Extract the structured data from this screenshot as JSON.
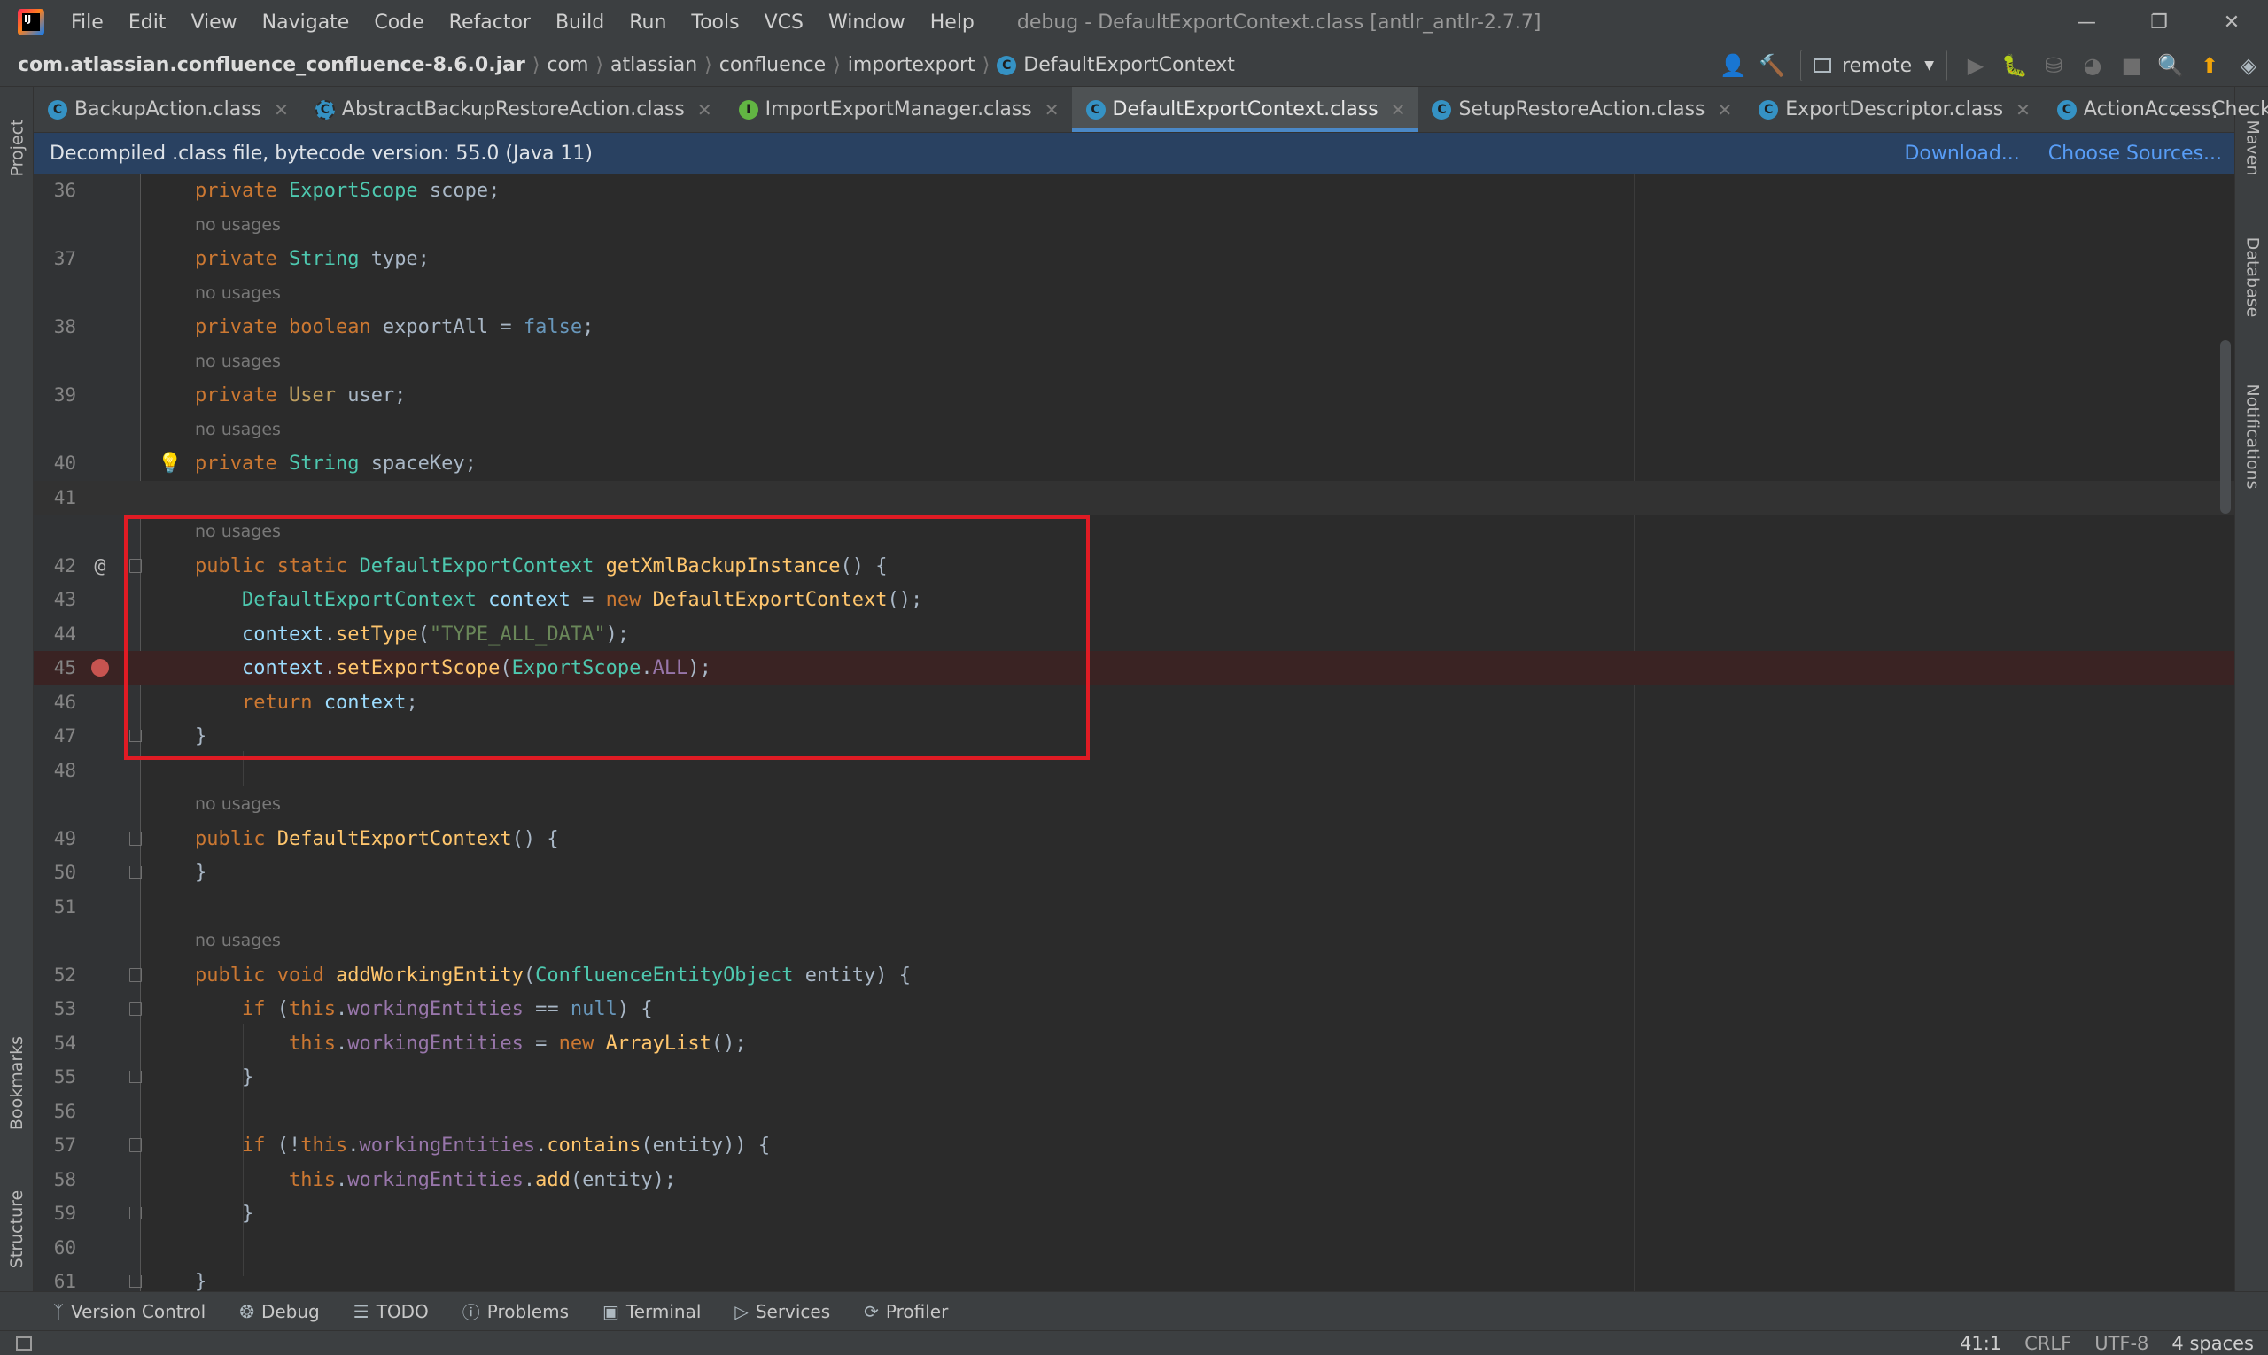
{
  "menubar": {
    "items": [
      "File",
      "Edit",
      "View",
      "Navigate",
      "Code",
      "Refactor",
      "Build",
      "Run",
      "Tools",
      "VCS",
      "Window",
      "Help"
    ],
    "window_title": "debug - DefaultExportContext.class [antlr_antlr-2.7.7]"
  },
  "breadcrumb": {
    "items": [
      "com.atlassian.confluence_confluence-8.6.0.jar",
      "com",
      "atlassian",
      "confluence",
      "importexport",
      "DefaultExportContext"
    ]
  },
  "toolbar": {
    "run_config": "remote"
  },
  "tabs": [
    {
      "label": "BackupAction.class",
      "icon": "class",
      "active": false
    },
    {
      "label": "AbstractBackupRestoreAction.class",
      "icon": "abstract-class",
      "active": false
    },
    {
      "label": "ImportExportManager.class",
      "icon": "interface",
      "active": false
    },
    {
      "label": "DefaultExportContext.class",
      "icon": "class",
      "active": true
    },
    {
      "label": "SetupRestoreAction.class",
      "icon": "class",
      "active": false
    },
    {
      "label": "ExportDescriptor.class",
      "icon": "class",
      "active": false
    },
    {
      "label": "ActionAccessChecker.c",
      "icon": "class",
      "active": false
    }
  ],
  "banner": {
    "text": "Decompiled .class file, bytecode version: 55.0 (Java 11)",
    "download": "Download...",
    "choose_sources": "Choose Sources..."
  },
  "side_tabs": {
    "project": "Project",
    "bookmarks": "Bookmarks",
    "structure": "Structure",
    "maven": "Maven",
    "database": "Database",
    "notifications": "Notifications"
  },
  "code": {
    "usage_hint": "no usages",
    "line_numbers": [
      "36",
      "37",
      "38",
      "39",
      "40",
      "41",
      "42",
      "43",
      "44",
      "45",
      "46",
      "47",
      "48",
      "49",
      "50",
      "51",
      "52",
      "53",
      "54",
      "55",
      "56",
      "57",
      "58",
      "59",
      "60",
      "61"
    ]
  },
  "bottom_tools": [
    "Version Control",
    "Debug",
    "TODO",
    "Problems",
    "Terminal",
    "Services",
    "Profiler"
  ],
  "status": {
    "position": "41:1",
    "line_sep": "CRLF",
    "encoding": "UTF-8",
    "indent": "4 spaces"
  },
  "colors": {
    "highlight_box": "#e01b24",
    "breakpoint": "#c75450",
    "active_tab_underline": "#4a88c7",
    "banner": "#294161"
  }
}
